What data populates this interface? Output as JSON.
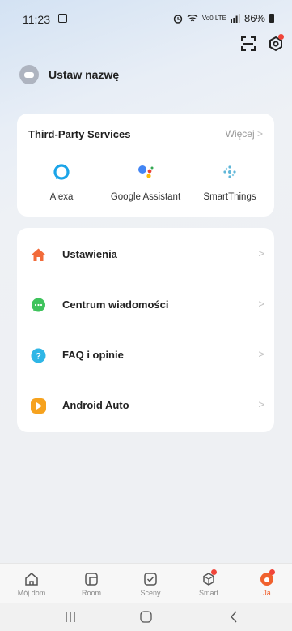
{
  "status_bar": {
    "time": "11:23",
    "signal": "Vo0 LTE",
    "battery": "86%"
  },
  "profile": {
    "name": "Ustaw nazwę"
  },
  "third_party": {
    "title": "Third-Party Services",
    "more": "Więcej",
    "services": [
      {
        "label": "Alexa",
        "icon": "alexa-icon"
      },
      {
        "label": "Google Assistant",
        "icon": "google-assistant-icon"
      },
      {
        "label": "SmartThings",
        "icon": "smartthings-icon"
      }
    ]
  },
  "menu": [
    {
      "label": "Ustawienia",
      "icon": "home-icon",
      "color": "#f26b3a"
    },
    {
      "label": "Centrum wiadomości",
      "icon": "message-icon",
      "color": "#3ec35c"
    },
    {
      "label": "FAQ i opinie",
      "icon": "question-icon",
      "color": "#2fb6e6"
    },
    {
      "label": "Android Auto",
      "icon": "play-icon",
      "color": "#f6a21e"
    }
  ],
  "tabs": [
    {
      "label": "Mój dom",
      "icon": "home-tab-icon"
    },
    {
      "label": "Room",
      "icon": "room-tab-icon"
    },
    {
      "label": "Sceny",
      "icon": "scenes-tab-icon"
    },
    {
      "label": "Smart",
      "icon": "smart-tab-icon"
    },
    {
      "label": "Ja",
      "icon": "me-tab-icon"
    }
  ],
  "colors": {
    "accent": "#f0612e",
    "badge": "#f0453a"
  }
}
